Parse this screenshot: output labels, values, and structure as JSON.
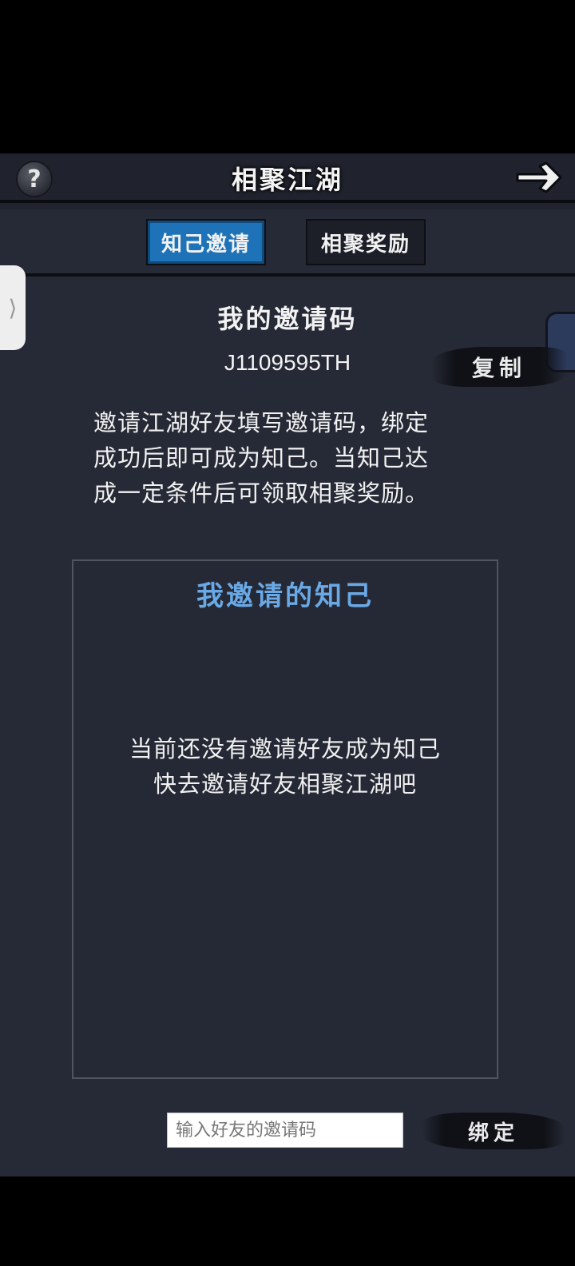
{
  "header": {
    "title": "相聚江湖",
    "help_icon": "question-mark-icon",
    "forward_icon": "arrow-right-icon"
  },
  "tabs": [
    {
      "label": "知己邀请",
      "active": true
    },
    {
      "label": "相聚奖励",
      "active": false
    }
  ],
  "invite": {
    "section_title": "我的邀请码",
    "code": "J1109595TH",
    "copy_label": "复制",
    "description_lines": [
      "邀请江湖好友填写邀请码，绑定",
      "成功后即可成为知己。当知己达",
      "成一定条件后可领取相聚奖励。"
    ]
  },
  "friends": {
    "title": "我邀请的知己",
    "empty_lines": [
      "当前还没有邀请好友成为知己",
      "快去邀请好友相聚江湖吧"
    ]
  },
  "bind": {
    "input_value": "",
    "input_placeholder": "输入好友的邀请码",
    "button_label": "绑定"
  },
  "side_handle": {
    "glyph": "⟩"
  },
  "colors": {
    "background": "#262a36",
    "active_tab": "#1e73b8",
    "accent_text": "#6aa9e6"
  }
}
